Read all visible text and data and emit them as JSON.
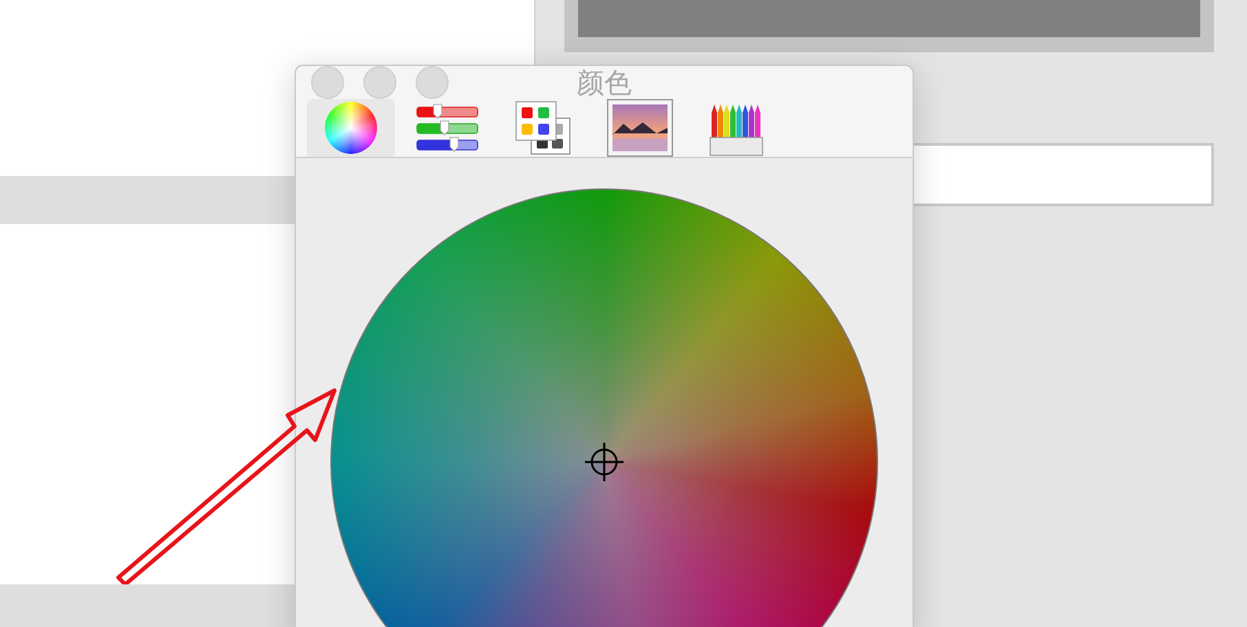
{
  "window": {
    "title": "颜色"
  },
  "tabs": [
    {
      "kind": "wheel",
      "selected": true
    },
    {
      "kind": "sliders",
      "selected": false
    },
    {
      "kind": "palettes",
      "selected": false
    },
    {
      "kind": "image",
      "selected": false
    },
    {
      "kind": "pencils",
      "selected": false
    }
  ]
}
